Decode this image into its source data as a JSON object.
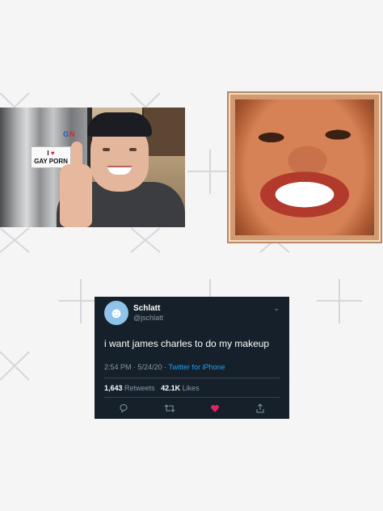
{
  "photo_sticker": {
    "sign_line1": "I",
    "sign_heart": "♥",
    "sign_line2": "GAY PORN",
    "magnets": [
      "G",
      "N"
    ]
  },
  "pixel_sticker": {
    "icon": "pixel-art-face"
  },
  "tweet": {
    "display_name": "Schlatt",
    "handle": "@jschlatt",
    "text": "i want james charles to do my makeup",
    "time": "2:54 PM",
    "date": "5/24/20",
    "client": "Twitter for iPhone",
    "retweets_count": "1,643",
    "retweets_label": "Retweets",
    "likes_count": "42.1K",
    "likes_label": "Likes",
    "colors": {
      "background": "#15202b",
      "accent": "#1da1f2",
      "like": "#e0245e"
    },
    "actions": [
      "reply-icon",
      "retweet-icon",
      "like-icon",
      "share-icon"
    ]
  }
}
